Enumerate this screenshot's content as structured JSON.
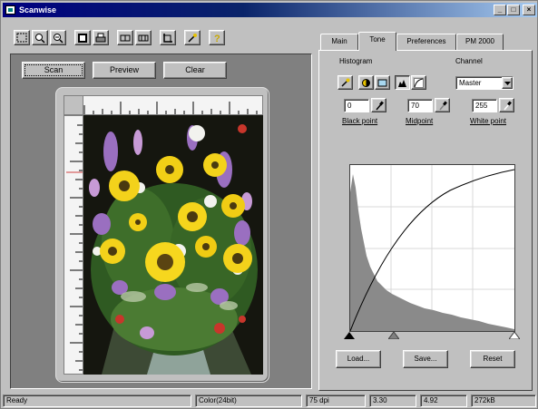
{
  "window": {
    "title": "Scanwise",
    "controls": [
      "minimize-icon",
      "maximize-icon",
      "close-icon"
    ]
  },
  "toolbar": {
    "icons": [
      "select-area-icon",
      "zoom-in-icon",
      "zoom-out-icon",
      "fit-icon",
      "print-icon",
      "rotate-left-icon",
      "rotate-right-icon",
      "crop-icon",
      "magic-wand-icon",
      "help-icon"
    ]
  },
  "preview": {
    "buttons": {
      "scan": "Scan",
      "preview": "Preview",
      "clear": "Clear"
    }
  },
  "tabs": [
    {
      "label": "Main",
      "active": false
    },
    {
      "label": "Tone",
      "active": true
    },
    {
      "label": "Preferences",
      "active": false
    },
    {
      "label": "PM 2000",
      "active": false
    }
  ],
  "tone": {
    "histogram_label": "Histogram",
    "channel_label": "Channel",
    "channel_value": "Master",
    "histogram_icons": [
      "auto-icon",
      "brightness-icon",
      "contrast-icon",
      "levels-icon",
      "curve-icon"
    ],
    "black_point": {
      "label": "Black point",
      "value": "0"
    },
    "midpoint": {
      "label": "Midpoint",
      "value": "70"
    },
    "white_point": {
      "label": "White point",
      "value": "255"
    },
    "buttons": {
      "load": "Load...",
      "save": "Save...",
      "reset": "Reset"
    }
  },
  "status": {
    "text": "Ready",
    "mode": "Color(24bit)",
    "resolution": "75 dpi",
    "width": "3.30",
    "height": "4.92",
    "size": "272kB"
  },
  "colors": {
    "titlebar_start": "#000080",
    "titlebar_end": "#a6caf0",
    "face": "#c0c0c0",
    "preview_bg": "#808080",
    "histogram_fill": "#8a8a8a"
  }
}
